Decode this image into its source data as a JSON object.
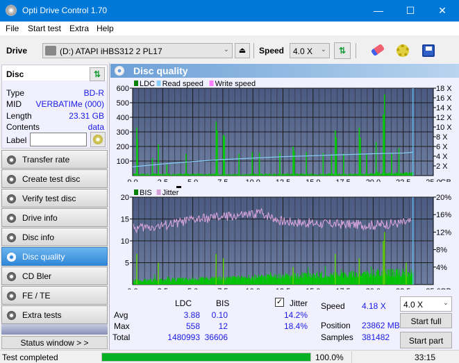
{
  "window": {
    "title": "Opti Drive Control 1.70",
    "minimize": "—",
    "maximize": "☐",
    "close": "✕"
  },
  "menu": [
    "File",
    "Start test",
    "Extra",
    "Help"
  ],
  "toolbar": {
    "drive_label": "Drive",
    "drive_value": "(D:)  ATAPI iHBS312   2 PL17",
    "speed_label": "Speed",
    "speed_value": "4.0 X"
  },
  "disc": {
    "header": "Disc",
    "fields": [
      {
        "key": "Type",
        "value": "BD-R"
      },
      {
        "key": "MID",
        "value": "VERBATIMe (000)"
      },
      {
        "key": "Length",
        "value": "23.31 GB"
      },
      {
        "key": "Contents",
        "value": "data"
      }
    ],
    "label_key": "Label",
    "label_value": ""
  },
  "nav": [
    {
      "label": "Transfer rate",
      "active": false
    },
    {
      "label": "Create test disc",
      "active": false
    },
    {
      "label": "Verify test disc",
      "active": false
    },
    {
      "label": "Drive info",
      "active": false
    },
    {
      "label": "Disc info",
      "active": false
    },
    {
      "label": "Disc quality",
      "active": true
    },
    {
      "label": "CD Bler",
      "active": false
    },
    {
      "label": "FE / TE",
      "active": false
    },
    {
      "label": "Extra tests",
      "active": false
    }
  ],
  "status_window_button": "Status window > >",
  "panel_title": "Disc quality",
  "chart_data": [
    {
      "type": "bar",
      "title": "LDC / Read speed",
      "legend": [
        {
          "name": "LDC",
          "color": "#008000"
        },
        {
          "name": "Read speed",
          "color": "#87cefa"
        },
        {
          "name": "Write speed",
          "color": "#ff80ff"
        }
      ],
      "xlabel": "GB",
      "xlim": [
        0,
        25
      ],
      "xticks": [
        "0.0",
        "2.5",
        "5.0",
        "7.5",
        "10.0",
        "12.5",
        "15.0",
        "17.5",
        "20.0",
        "22.5",
        "25.0"
      ],
      "ylim": [
        0,
        600
      ],
      "yticks": [
        "100",
        "200",
        "300",
        "400",
        "500",
        "600"
      ],
      "y2lim": [
        0,
        18
      ],
      "y2ticks": [
        "2 X",
        "4 X",
        "6 X",
        "8 X",
        "10 X",
        "12 X",
        "14 X",
        "16 X",
        "18 X"
      ],
      "end_marker_gb": 23.31,
      "ldc_spikes": [
        [
          0.3,
          330
        ],
        [
          0.35,
          250
        ],
        [
          1.6,
          120
        ],
        [
          2.1,
          215
        ],
        [
          2.8,
          75
        ],
        [
          4.4,
          150
        ],
        [
          6.9,
          370
        ],
        [
          7.0,
          310
        ],
        [
          7.5,
          280
        ],
        [
          7.6,
          270
        ],
        [
          8.8,
          150
        ],
        [
          9.9,
          160
        ],
        [
          10.5,
          155
        ],
        [
          12.2,
          155
        ],
        [
          13.3,
          200
        ],
        [
          13.4,
          170
        ],
        [
          14.4,
          160
        ],
        [
          15.8,
          155
        ],
        [
          16.5,
          150
        ],
        [
          16.8,
          310
        ],
        [
          16.9,
          260
        ],
        [
          17.5,
          150
        ],
        [
          18.8,
          330
        ],
        [
          18.9,
          260
        ],
        [
          19.4,
          150
        ],
        [
          20.2,
          230
        ],
        [
          20.8,
          420
        ],
        [
          20.9,
          558
        ],
        [
          21.5,
          150
        ],
        [
          22.1,
          190
        ]
      ],
      "ldc_baseline": 10,
      "read_speed": [
        [
          0,
          1.8
        ],
        [
          2.5,
          2.4
        ],
        [
          5.0,
          2.9
        ],
        [
          7.5,
          3.3
        ],
        [
          10.0,
          3.6
        ],
        [
          12.5,
          3.9
        ],
        [
          15.0,
          4.1
        ],
        [
          17.5,
          4.3
        ],
        [
          20.0,
          4.5
        ],
        [
          22.5,
          4.65
        ],
        [
          23.31,
          4.8
        ]
      ]
    },
    {
      "type": "bar",
      "title": "BIS / Jitter",
      "legend": [
        {
          "name": "BIS",
          "color": "#008000"
        },
        {
          "name": "Jitter",
          "color": "#d8a0d8"
        }
      ],
      "xlabel": "GB",
      "xlim": [
        0,
        25
      ],
      "xticks": [
        "0.0",
        "2.5",
        "5.0",
        "7.5",
        "10.0",
        "12.5",
        "15.0",
        "17.5",
        "20.0",
        "22.5",
        "25.0"
      ],
      "ylim": [
        0,
        20
      ],
      "yticks": [
        "5",
        "10",
        "15",
        "20"
      ],
      "y2lim": [
        0,
        20
      ],
      "y2ticks": [
        "4%",
        "8%",
        "12%",
        "16%",
        "20%"
      ],
      "end_marker_gb": 23.31,
      "bis_spikes": [
        [
          0.3,
          7
        ],
        [
          2.1,
          5
        ],
        [
          6.9,
          7
        ],
        [
          7.5,
          6
        ],
        [
          13.3,
          4
        ],
        [
          16.8,
          7
        ],
        [
          18.8,
          6
        ],
        [
          20.8,
          10
        ],
        [
          20.9,
          12
        ],
        [
          22.7,
          5
        ]
      ],
      "bis_baseline": [
        [
          0,
          1
        ],
        [
          7.5,
          1.5
        ],
        [
          12.5,
          2
        ],
        [
          17.5,
          2.5
        ],
        [
          23.31,
          3
        ]
      ],
      "jitter_trend": [
        [
          0,
          12.8
        ],
        [
          2.5,
          13.5
        ],
        [
          5.0,
          14.8
        ],
        [
          7.5,
          15.5
        ],
        [
          10.0,
          16.0
        ],
        [
          10.5,
          16.6
        ],
        [
          12.5,
          14.5
        ],
        [
          15.0,
          14.0
        ],
        [
          17.5,
          13.8
        ],
        [
          20.0,
          13.6
        ],
        [
          23.31,
          14.3
        ]
      ]
    }
  ],
  "stats": {
    "col_ldc": "LDC",
    "col_bis": "BIS",
    "jitter_label": "Jitter",
    "jitter_checked": true,
    "rows": [
      {
        "label": "Avg",
        "ldc": "3.88",
        "bis": "0.10",
        "jitter": "14.2%"
      },
      {
        "label": "Max",
        "ldc": "558",
        "bis": "12",
        "jitter": "18.4%"
      },
      {
        "label": "Total",
        "ldc": "1480993",
        "bis": "36606",
        "jitter": ""
      }
    ],
    "speed_label": "Speed",
    "speed_value": "4.18 X",
    "position_label": "Position",
    "position_value": "23862 MB",
    "samples_label": "Samples",
    "samples_value": "381482",
    "speed_select": "4.0 X",
    "start_full": "Start full",
    "start_part": "Start part"
  },
  "status": {
    "text": "Test completed",
    "progress_percent": 100,
    "progress_label": "100.0%",
    "time": "33:15"
  }
}
